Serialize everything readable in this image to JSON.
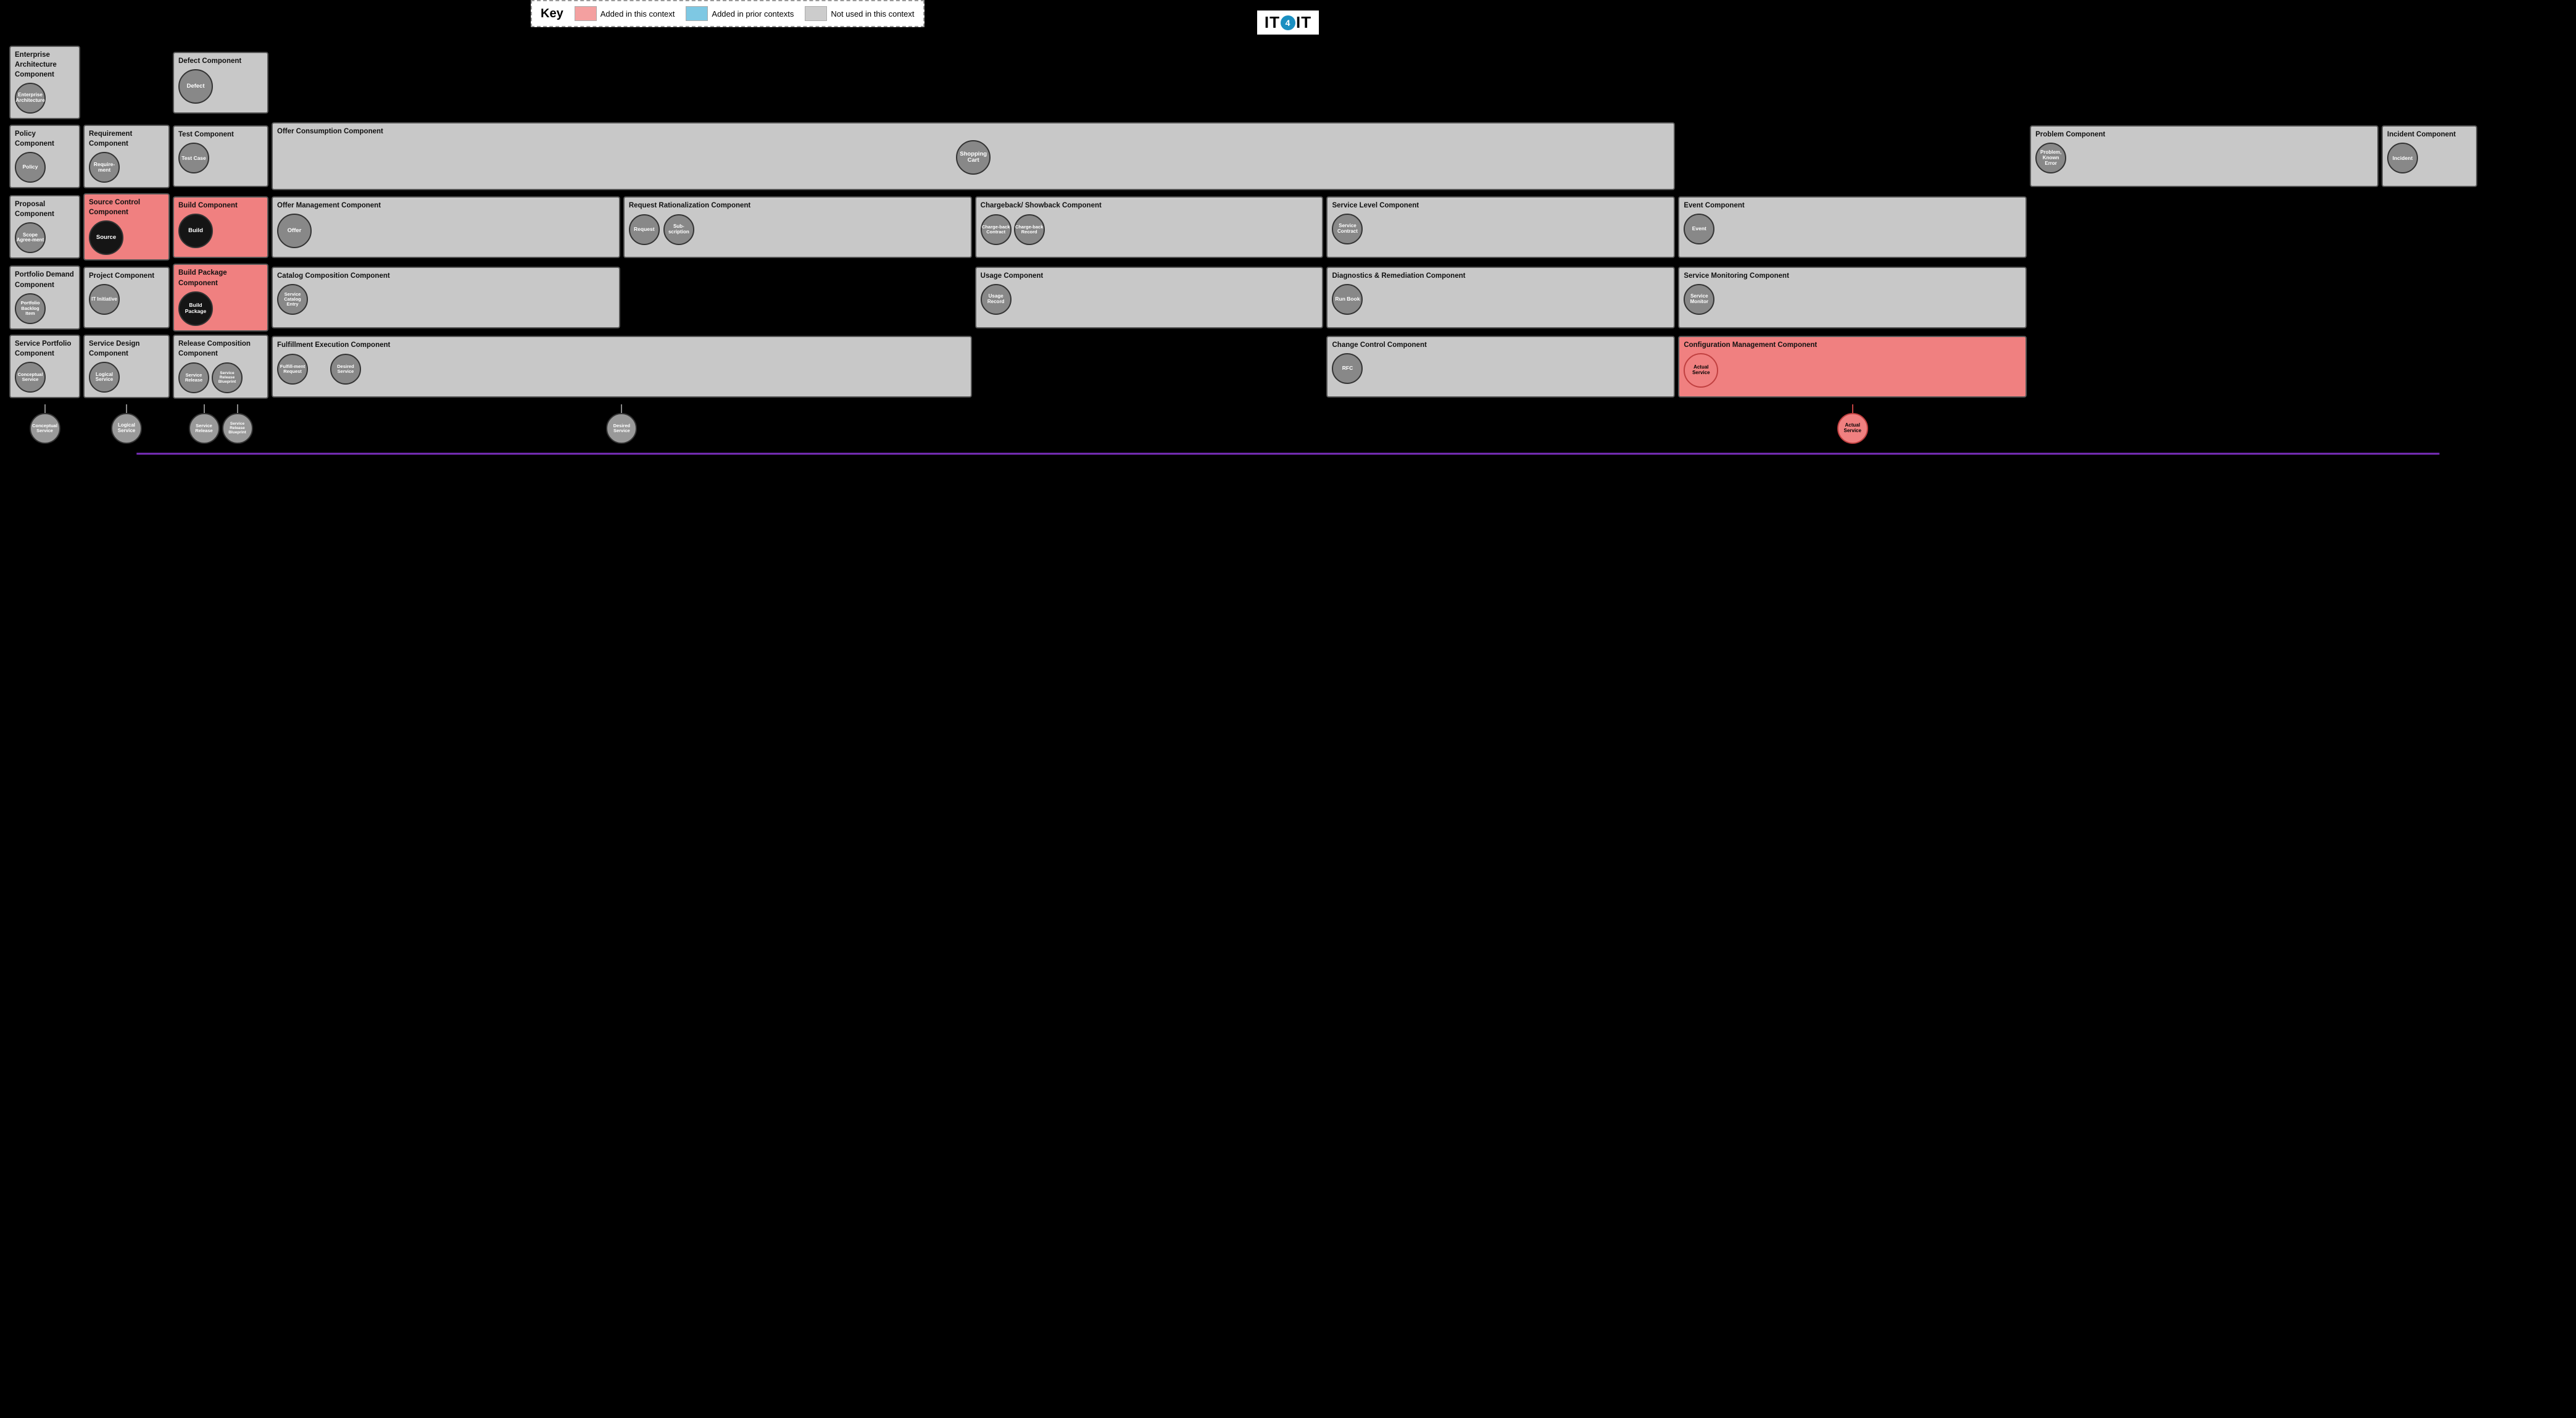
{
  "logo": {
    "text": "IT4IT",
    "alt": "IT4IT Logo"
  },
  "key": {
    "title": "Key",
    "items": [
      {
        "color": "pink",
        "label": "Added in this context"
      },
      {
        "color": "blue",
        "label": "Added in prior contexts"
      },
      {
        "color": "gray",
        "label": "Not used in this context"
      }
    ]
  },
  "rows": [
    {
      "id": "row0",
      "cells": [
        {
          "id": "enterprise-arch",
          "title": "Enterprise Architecture Component",
          "color": "gray",
          "circle": {
            "label": "Enterprise Architecture",
            "dark": false
          },
          "colspan": 1
        },
        {
          "id": "empty-r0c1",
          "title": "",
          "color": "void",
          "colspan": 1
        },
        {
          "id": "defect-comp",
          "title": "Defect Component",
          "color": "gray",
          "circle": {
            "label": "Defect",
            "dark": false
          },
          "colspan": 1
        },
        {
          "id": "empty-r0c3",
          "title": "",
          "color": "void",
          "colspan": 1
        },
        {
          "id": "empty-r0c4",
          "title": "",
          "color": "void",
          "colspan": 1
        },
        {
          "id": "empty-r0c5",
          "title": "",
          "color": "void",
          "colspan": 1
        },
        {
          "id": "empty-r0c6",
          "title": "",
          "color": "void",
          "colspan": 1
        },
        {
          "id": "empty-r0c7",
          "title": "",
          "color": "void",
          "colspan": 1
        },
        {
          "id": "empty-r0c8",
          "title": "",
          "color": "void",
          "colspan": 1
        },
        {
          "id": "empty-r0c9",
          "title": "",
          "color": "void",
          "colspan": 1
        },
        {
          "id": "empty-r0c10",
          "title": "",
          "color": "void",
          "colspan": 1
        }
      ]
    },
    {
      "id": "row1",
      "cells": [
        {
          "id": "policy-comp",
          "title": "Policy Component",
          "color": "gray",
          "circle": {
            "label": "Policy",
            "dark": false
          },
          "colspan": 1
        },
        {
          "id": "requirement-comp",
          "title": "Requirement Component",
          "color": "gray",
          "circle": {
            "label": "Require-ment",
            "dark": false
          },
          "colspan": 1
        },
        {
          "id": "test-comp",
          "title": "Test Component",
          "color": "gray",
          "circle": {
            "label": "Test Case",
            "dark": false
          },
          "colspan": 1
        },
        {
          "id": "offer-consumption-comp",
          "title": "Offer Consumption Component",
          "color": "gray",
          "circle": {
            "label": "Shopping Cart",
            "dark": false
          },
          "colspan": 4
        },
        {
          "id": "empty-r1c7",
          "title": "",
          "color": "void",
          "colspan": 1
        },
        {
          "id": "problem-comp",
          "title": "Problem Component",
          "color": "gray",
          "circle": {
            "label": "Problem, Known Error",
            "dark": false
          },
          "colspan": 1
        },
        {
          "id": "incident-comp",
          "title": "Incident Component",
          "color": "gray",
          "circle": {
            "label": "Incident",
            "dark": false
          },
          "colspan": 1
        }
      ]
    },
    {
      "id": "row2",
      "cells": [
        {
          "id": "proposal-comp",
          "title": "Proposal Component",
          "color": "gray",
          "circle": {
            "label": "Scope Agree-ment",
            "dark": false
          },
          "colspan": 1
        },
        {
          "id": "source-control-comp",
          "title": "Source Control Component",
          "color": "pink",
          "circle": {
            "label": "Source",
            "dark": true
          },
          "colspan": 1
        },
        {
          "id": "build-comp",
          "title": "Build Component",
          "color": "pink",
          "circle": {
            "label": "Build",
            "dark": true
          },
          "colspan": 1
        },
        {
          "id": "offer-mgmt-comp",
          "title": "Offer Management Component",
          "color": "gray",
          "circle": {
            "label": "Offer",
            "dark": false
          },
          "colspan": 1
        },
        {
          "id": "request-rationalization-comp",
          "title": "Request Rationalization Component",
          "color": "gray",
          "circles": [
            {
              "label": "Request",
              "dark": false
            },
            {
              "label": "Sub-scription",
              "dark": false
            }
          ],
          "colspan": 1
        },
        {
          "id": "chargeback-comp",
          "title": "Chargeback/ Showback Component",
          "color": "gray",
          "circles": [
            {
              "label": "Charge-back Contract",
              "dark": false
            },
            {
              "label": "Charge-back Record",
              "dark": false
            }
          ],
          "colspan": 1
        },
        {
          "id": "service-level-comp",
          "title": "Service Level Component",
          "color": "gray",
          "circle": {
            "label": "Service Contract",
            "dark": false
          },
          "colspan": 1
        },
        {
          "id": "event-comp",
          "title": "Event Component",
          "color": "gray",
          "circle": {
            "label": "Event",
            "dark": false
          },
          "colspan": 1
        }
      ]
    },
    {
      "id": "row3",
      "cells": [
        {
          "id": "portfolio-demand-comp",
          "title": "Portfolio Demand Component",
          "color": "gray",
          "circle": {
            "label": "Portfolio Backlog Item",
            "dark": false
          },
          "colspan": 1
        },
        {
          "id": "project-comp",
          "title": "Project Component",
          "color": "gray",
          "circle": {
            "label": "IT Initiative",
            "dark": false
          },
          "colspan": 1
        },
        {
          "id": "build-package-comp",
          "title": "Build Package Component",
          "color": "pink",
          "circle": {
            "label": "Build Package",
            "dark": true
          },
          "colspan": 1
        },
        {
          "id": "catalog-composition-comp",
          "title": "Catalog Composition Component",
          "color": "gray",
          "circle": {
            "label": "Service Catalog Entry",
            "dark": false
          },
          "colspan": 1
        },
        {
          "id": "empty-r3c4",
          "title": "",
          "color": "void",
          "colspan": 1
        },
        {
          "id": "usage-comp",
          "title": "Usage Component",
          "color": "gray",
          "circle": {
            "label": "Usage Record",
            "dark": false
          },
          "colspan": 1
        },
        {
          "id": "diagnostics-remediation-comp",
          "title": "Diagnostics & Remediation Component",
          "color": "gray",
          "circle": {
            "label": "Run Book",
            "dark": false
          },
          "colspan": 1
        },
        {
          "id": "service-monitoring-comp",
          "title": "Service Monitoring Component",
          "color": "gray",
          "circle": {
            "label": "Service Monitor",
            "dark": false
          },
          "colspan": 1
        }
      ]
    },
    {
      "id": "row4",
      "cells": [
        {
          "id": "service-portfolio-comp",
          "title": "Service Portfolio Component",
          "color": "gray",
          "circle": {
            "label": "Conceptual Service",
            "dark": false
          },
          "colspan": 1
        },
        {
          "id": "service-design-comp",
          "title": "Service Design Component",
          "color": "gray",
          "circle": {
            "label": "Logical Service",
            "dark": false
          },
          "colspan": 1
        },
        {
          "id": "release-composition-comp",
          "title": "Release Composition Component",
          "color": "gray",
          "circles": [
            {
              "label": "Service Release",
              "dark": false
            },
            {
              "label": "Service Release Blueprint",
              "dark": false
            }
          ],
          "colspan": 1
        },
        {
          "id": "fulfillment-exec-comp",
          "title": "Fulfillment Execution Component",
          "color": "gray",
          "circle": {
            "label": "Fulfill-ment Request",
            "dark": false
          },
          "colspan": 2
        },
        {
          "id": "empty-r4c4",
          "title": "",
          "color": "void",
          "colspan": 1
        },
        {
          "id": "change-control-comp",
          "title": "Change Control Component",
          "color": "gray",
          "circle": {
            "label": "RFC",
            "dark": false
          },
          "colspan": 1
        },
        {
          "id": "config-mgmt-comp",
          "title": "Configuration Management Component",
          "color": "pink",
          "circle": {
            "label": "Actual Service",
            "dark": false,
            "pink": true
          },
          "colspan": 1
        }
      ]
    }
  ],
  "bottom_nodes": [
    {
      "id": "conceptual-service-node",
      "label": "Conceptual Service",
      "color": "gray"
    },
    {
      "id": "logical-service-node",
      "label": "Logical Service",
      "color": "gray"
    },
    {
      "id": "service-release-node",
      "label": "Service Release",
      "color": "gray"
    },
    {
      "id": "service-release-blueprint-node",
      "label": "Service Release Blueprint",
      "color": "gray"
    },
    {
      "id": "desired-service-node",
      "label": "Desired Service",
      "color": "gray"
    },
    {
      "id": "actual-service-node",
      "label": "Actual Service",
      "color": "pink"
    }
  ]
}
